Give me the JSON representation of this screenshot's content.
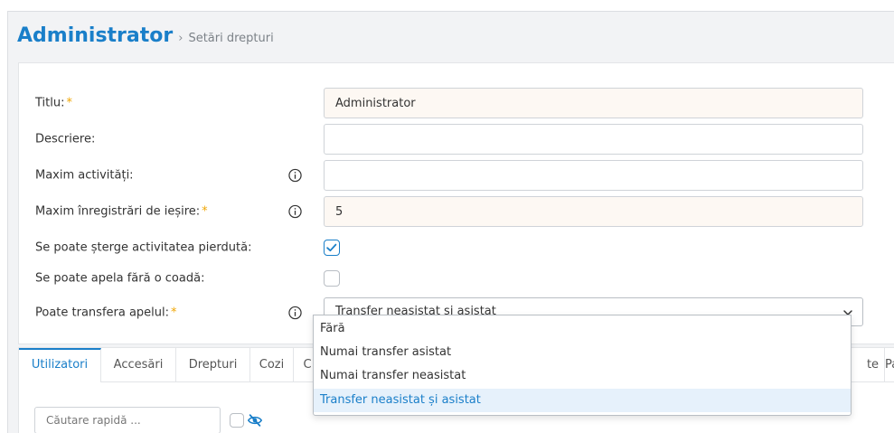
{
  "breadcrumb": {
    "title": "Administrator",
    "separator": "›",
    "subtitle": "Setări drepturi"
  },
  "form": {
    "title": {
      "label": "Titlu:",
      "required_mark": "*",
      "value": "Administrator"
    },
    "description": {
      "label": "Descriere:",
      "value": ""
    },
    "max_activities": {
      "label": "Maxim activități:",
      "value": ""
    },
    "max_outgoing": {
      "label": "Maxim înregistrări de ieșire:",
      "required_mark": "*",
      "value": "5"
    },
    "can_delete_lost": {
      "label": "Se poate șterge activitatea pierdută:",
      "checked": true
    },
    "can_call_without_queue": {
      "label": "Se poate apela fără o coadă:",
      "checked": false
    },
    "can_transfer": {
      "label": "Poate transfera apelul:",
      "required_mark": "*",
      "selected": "Transfer neasistat și asistat",
      "options": [
        "Fără",
        "Numai transfer asistat",
        "Numai transfer neasistat",
        "Transfer neasistat și asistat"
      ]
    }
  },
  "tabs": [
    "Utilizatori",
    "Accesări",
    "Drepturi",
    "Cozi",
    "C",
    "te",
    "Pa"
  ],
  "search": {
    "placeholder": "Căutare rapidă ..."
  },
  "colors": {
    "accent": "#1a7fc9",
    "required": "#f0a500",
    "selected_option_bg": "#e6f1fb"
  },
  "icons": {
    "info": "info-circle-icon",
    "chevron": "chevron-down-icon",
    "check": "checkmark-icon",
    "eye": "eye-slash-icon"
  }
}
